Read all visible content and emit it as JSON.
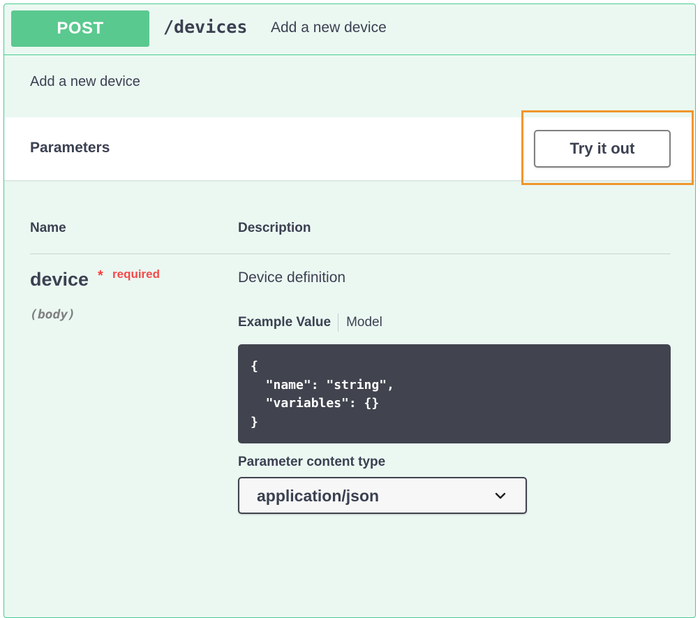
{
  "summary": {
    "method": "POST",
    "path": "/devices",
    "description": "Add a new device"
  },
  "description": "Add a new device",
  "parameters": {
    "title": "Parameters",
    "try_button": "Try it out",
    "columns": {
      "name": "Name",
      "description": "Description"
    },
    "items": [
      {
        "name": "device",
        "required_star": "*",
        "required_label": "required",
        "in": "(body)",
        "description": "Device definition",
        "tabs": {
          "example": "Example Value",
          "model": "Model"
        },
        "example_code": "{\n  \"name\": \"string\",\n  \"variables\": {}\n}",
        "content_type_label": "Parameter content type",
        "content_type_value": "application/json"
      }
    ]
  },
  "colors": {
    "post_accent": "#49cc90",
    "post_background": "#ebf8f2",
    "highlight": "#f0962e",
    "required": "#f93e3e",
    "code_background": "#41444e"
  },
  "icons": {
    "select_arrow": "chevron-down-icon"
  }
}
